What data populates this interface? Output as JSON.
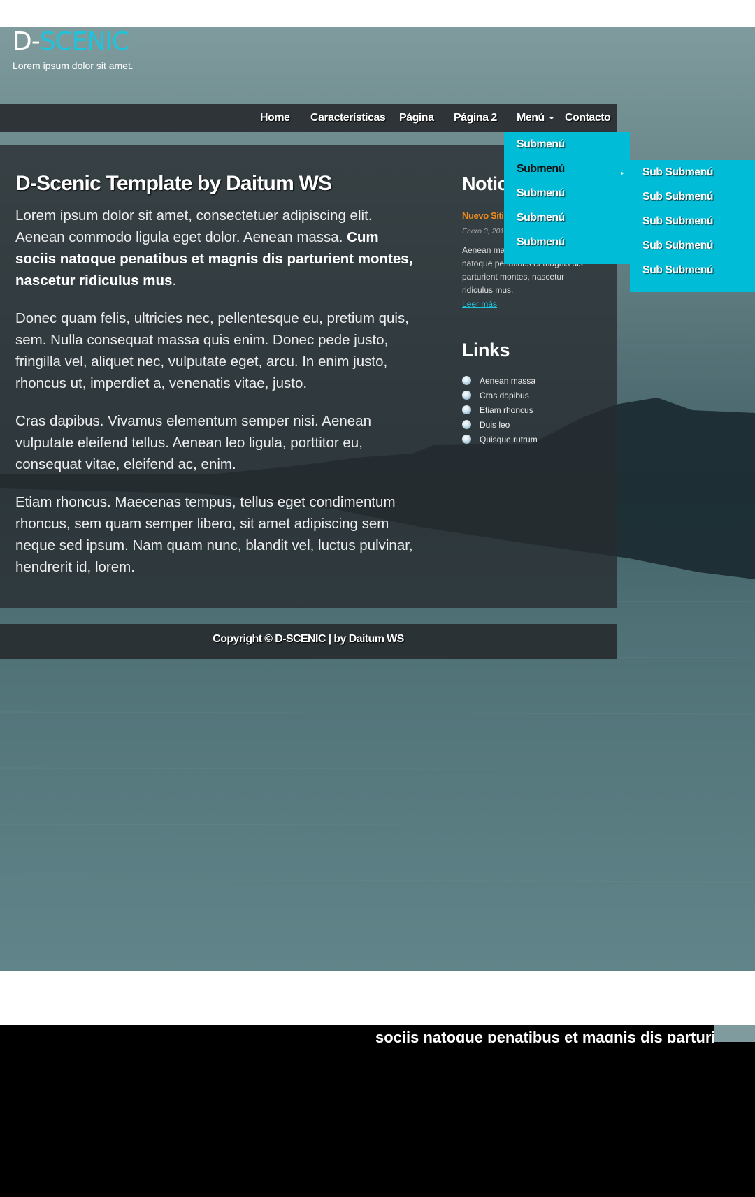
{
  "site": {
    "logo_prefix": "D-",
    "logo_accent": "SCENIC",
    "tagline": "Lorem ipsum dolor sit amet.",
    "accent_color": "#1ec3dc"
  },
  "nav": {
    "items": [
      "Home",
      "Características",
      "Página",
      "Página 2",
      "Menú",
      "Contacto"
    ]
  },
  "submenu": {
    "items": [
      "Submenú",
      "Submenú",
      "Submenú",
      "Submenú",
      "Submenú"
    ],
    "subitems": [
      "Sub Submenú",
      "Sub Submenú",
      "Sub Submenú",
      "Sub Submenú",
      "Sub Submenú"
    ]
  },
  "main": {
    "title": "D-Scenic Template by Daitum WS",
    "p1_text": "Lorem ipsum dolor sit amet, consectetuer adipiscing elit. Aenean commodo ligula eget dolor. Aenean massa. ",
    "p1_bold": "Cum sociis natoque penatibus et magnis dis parturient montes, nascetur ridiculus mus",
    "p1_end": ".",
    "p2": "Donec quam felis, ultricies nec, pellentesque eu, pretium quis, sem. Nulla consequat massa quis enim. Donec pede justo, fringilla vel, aliquet nec, vulputate eget, arcu. In enim justo, rhoncus ut, imperdiet a, venenatis vitae, justo.",
    "p3": "Cras dapibus. Vivamus elementum semper nisi. Aenean vulputate eleifend tellus. Aenean leo ligula, porttitor eu, consequat vitae, eleifend ac, enim.",
    "p4": "Etiam rhoncus. Maecenas tempus, tellus eget condimentum rhoncus, sem quam semper libero, sit amet adipiscing sem neque sed ipsum. Nam quam nunc, blandit vel, luctus pulvinar, hendrerit id, lorem."
  },
  "sidebar": {
    "news_heading": "Noticias",
    "news_title": "Nuevo Sitio",
    "news_date": "Enero 3, 2014",
    "news_text": "Aenean massa. Cum sociis natoque penatibus et magnis dis parturient montes, nascetur ridiculus mus.",
    "news_more": "Leer más",
    "links_heading": "Links",
    "links": [
      "Aenean massa",
      "Cras dapibus",
      "Etiam rhoncus",
      "Duis leo",
      "Quisque rutrum"
    ]
  },
  "footer": {
    "text": "Copyright © D-SCENIC | by Daitum WS"
  },
  "overflow_text": "sociis natoque penatibus et magnis dis parturient montes"
}
